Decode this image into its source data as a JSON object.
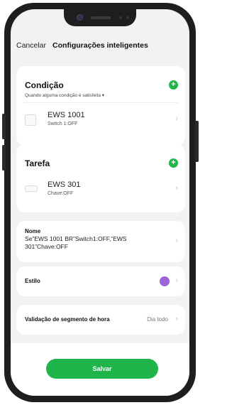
{
  "header": {
    "cancel_label": "Cancelar",
    "title": "Configurações inteligentes"
  },
  "condition": {
    "title": "Condição",
    "subtitle": "Quando alguma condição é satisfeita ▾",
    "device": {
      "name": "EWS 1001",
      "status": "Switch 1:OFF"
    }
  },
  "task": {
    "title": "Tarefa",
    "device": {
      "name": "EWS 301",
      "status": "Chave:OFF"
    }
  },
  "name_row": {
    "label": "Nome",
    "value": "Se”EWS 1001 BR”Switch1:OFF,”EWS 301”Chave:OFF"
  },
  "style_row": {
    "label": "Estilo",
    "color": "#9b63d8"
  },
  "time_row": {
    "label": "Validação de segmento de hora",
    "value": "Dia todo"
  },
  "save_label": "Salvar",
  "colors": {
    "accent": "#1fb54a",
    "background": "#f2f2f4"
  },
  "icons": {
    "add": "plus-icon",
    "chevron": "chevron-right-icon"
  }
}
